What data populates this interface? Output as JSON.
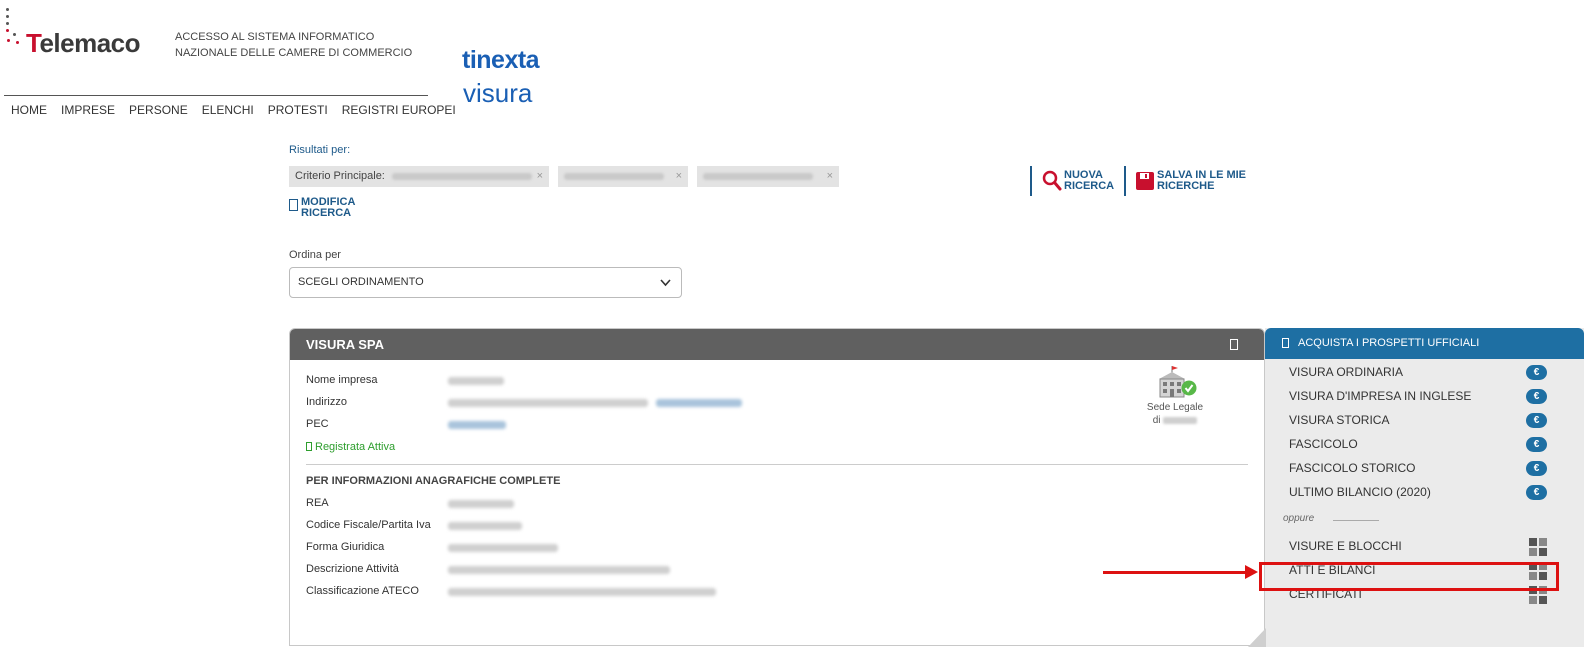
{
  "header": {
    "logo_text": "Telemaco",
    "tagline_line1": "ACCESSO AL SISTEMA INFORMATICO",
    "tagline_line2": "NAZIONALE DELLE CAMERE DI COMMERCIO",
    "brand_line1": "tinexta",
    "brand_line2": "visura"
  },
  "nav": {
    "items": [
      "HOME",
      "IMPRESE",
      "PERSONE",
      "ELENCHI",
      "PROTESTI",
      "REGISTRI EUROPEI"
    ]
  },
  "search": {
    "results_label": "Risultati per:",
    "chip1_label": "Criterio Principale:",
    "chip_close": "×",
    "modify_label": "MODIFICA RICERCA",
    "new_search_label": "NUOVA RICERCA",
    "save_label": "SALVA IN LE MIE RICERCHE"
  },
  "sort": {
    "label": "Ordina per",
    "selected": "SCEGLI ORDINAMENTO"
  },
  "result": {
    "title": "VISURA SPA",
    "fields": {
      "nome_impresa": "Nome impresa",
      "indirizzo": "Indirizzo",
      "pec": "PEC"
    },
    "status": "Registrata Attiva",
    "section_title": "PER INFORMAZIONI ANAGRAFICHE COMPLETE",
    "fields2": {
      "rea": "REA",
      "codice_fiscale": "Codice Fiscale/Partita Iva",
      "forma_giuridica": "Forma Giuridica",
      "descrizione_attivita": "Descrizione Attività",
      "classificazione_ateco": "Classificazione ATECO"
    },
    "sede_line1": "Sede Legale",
    "sede_line2": "di"
  },
  "side_panel": {
    "title": "ACQUISTA I PROSPETTI UFFICIALI",
    "currency_symbol": "€",
    "paid_items": [
      "VISURA ORDINARIA",
      "VISURA D'IMPRESA IN INGLESE",
      "VISURA STORICA",
      "FASCICOLO",
      "FASCICOLO STORICO",
      "ULTIMO BILANCIO (2020)"
    ],
    "oppure": "oppure",
    "other_items": [
      "VISURE E BLOCCHI",
      "ATTI E BILANCI",
      "CERTIFICATI"
    ]
  },
  "colors": {
    "accent_blue": "#1e6fa3",
    "link_blue": "#1e5a8a",
    "brand_red": "#c8102e",
    "status_green": "#2e9e2e",
    "highlight_red": "#dd1111"
  }
}
